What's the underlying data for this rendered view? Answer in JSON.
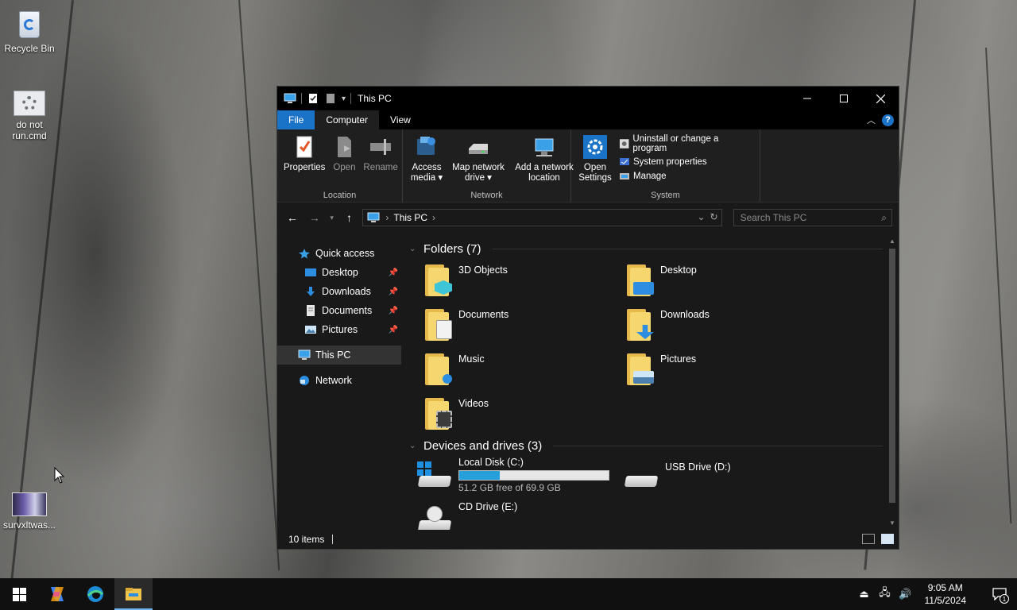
{
  "desktop": {
    "icons": [
      {
        "label": "Recycle Bin"
      },
      {
        "label": "do not run.cmd"
      },
      {
        "label": "survxltwas..."
      }
    ]
  },
  "window": {
    "title": "This PC",
    "ribbon_tabs": [
      "File",
      "Computer",
      "View"
    ],
    "groups": {
      "location": {
        "label": "Location",
        "buttons": [
          "Properties",
          "Open",
          "Rename"
        ]
      },
      "network": {
        "label": "Network",
        "access_media": "Access media ▾",
        "map_drive": "Map network drive ▾",
        "add_location": "Add a network location"
      },
      "system": {
        "label": "System",
        "open_settings": "Open Settings",
        "items": [
          "Uninstall or change a program",
          "System properties",
          "Manage"
        ]
      }
    },
    "address": {
      "path": "This PC",
      "search_placeholder": "Search This PC"
    },
    "nav_pane": {
      "quick_access": "Quick access",
      "quick_items": [
        "Desktop",
        "Downloads",
        "Documents",
        "Pictures"
      ],
      "this_pc": "This PC",
      "network": "Network"
    },
    "folders": {
      "heading": "Folders (7)",
      "items": [
        "3D Objects",
        "Desktop",
        "Documents",
        "Downloads",
        "Music",
        "Pictures",
        "Videos"
      ]
    },
    "drives": {
      "heading": "Devices and drives (3)",
      "local_disk": {
        "name": "Local Disk (C:)",
        "free_text": "51.2 GB free of 69.9 GB",
        "used_fraction": 0.27
      },
      "usb": {
        "name": "USB Drive (D:)"
      },
      "cd": {
        "name": "CD Drive (E:)"
      }
    },
    "status": {
      "items_count": "10 items"
    }
  },
  "taskbar": {
    "time": "9:05 AM",
    "date": "11/5/2024",
    "notification_count": "1"
  },
  "colors": {
    "accent": "#1a73c6",
    "progress": "#26a0da",
    "folder": "#f6d66e"
  }
}
